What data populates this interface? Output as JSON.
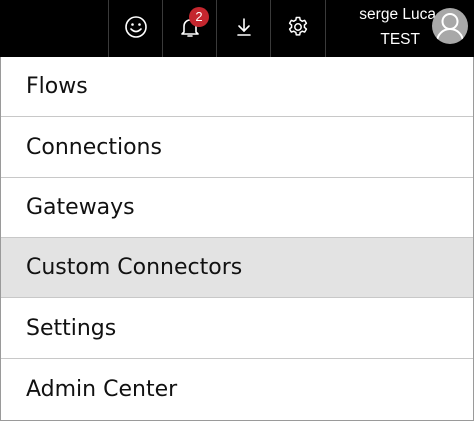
{
  "header": {
    "notification_count": "2",
    "user_name": "serge Luca",
    "user_org": "TEST",
    "icons": [
      "smiley-icon",
      "bell-icon",
      "download-icon",
      "gear-icon",
      "avatar-icon"
    ],
    "colors": {
      "bar": "#000000",
      "badge": "#c4262e",
      "highlight": "#e3e3e3"
    }
  },
  "menu": {
    "items": [
      {
        "label": "Flows"
      },
      {
        "label": "Connections"
      },
      {
        "label": "Gateways"
      },
      {
        "label": "Custom Connectors"
      },
      {
        "label": "Settings"
      },
      {
        "label": "Admin Center"
      }
    ],
    "highlighted_item": "Custom Connectors"
  }
}
